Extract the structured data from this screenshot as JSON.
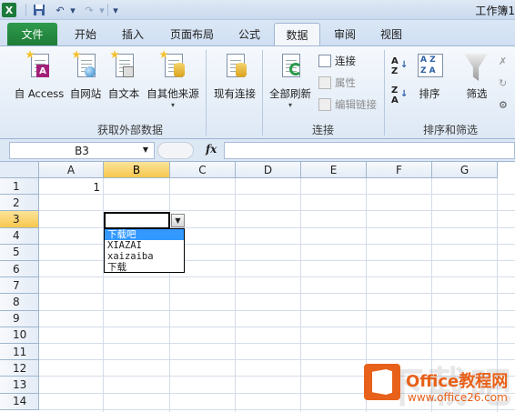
{
  "window": {
    "title": "工作簿1"
  },
  "tabs": [
    {
      "label": "文件"
    },
    {
      "label": "开始"
    },
    {
      "label": "插入"
    },
    {
      "label": "页面布局"
    },
    {
      "label": "公式"
    },
    {
      "label": "数据"
    },
    {
      "label": "审阅"
    },
    {
      "label": "视图"
    }
  ],
  "active_tab": "数据",
  "ribbon": {
    "get_external": {
      "label": "获取外部数据",
      "buttons": [
        {
          "label": "自 Access",
          "icon": "access-icon"
        },
        {
          "label": "自网站",
          "icon": "web-icon"
        },
        {
          "label": "自文本",
          "icon": "text-file-icon"
        },
        {
          "label": "自其他来源",
          "icon": "other-source-icon"
        },
        {
          "label": "现有连接",
          "icon": "existing-connection-icon"
        }
      ]
    },
    "connections": {
      "label": "连接",
      "refresh_all": "全部刷新",
      "connections": "连接",
      "properties": "属性",
      "edit_links": "编辑链接"
    },
    "sort_filter": {
      "label": "排序和筛选",
      "sort": "排序",
      "filter": "筛选"
    }
  },
  "formula_bar": {
    "name_box": "B3",
    "fx": "fx",
    "formula": ""
  },
  "grid": {
    "columns": [
      "A",
      "B",
      "C",
      "D",
      "E",
      "F",
      "G"
    ],
    "rows": [
      "1",
      "2",
      "3",
      "4",
      "5",
      "6",
      "7",
      "8",
      "9",
      "10",
      "11",
      "12",
      "13",
      "14"
    ],
    "selected_column": "B",
    "selected_row": "3",
    "cells": {
      "A1": "1"
    }
  },
  "dropdown": {
    "options": [
      "下载吧",
      "XIAZAI",
      "xaizaiba",
      "下载"
    ],
    "highlighted_index": 0
  },
  "watermark": {
    "cn_text": "下载吧",
    "brand": "Office教程网",
    "url": "www.office26.com"
  },
  "colors": {
    "excel_green": "#1e7c37",
    "selection_gold": "#f7c74d",
    "highlight_blue": "#3399ff",
    "brand_orange": "#e8611a"
  }
}
